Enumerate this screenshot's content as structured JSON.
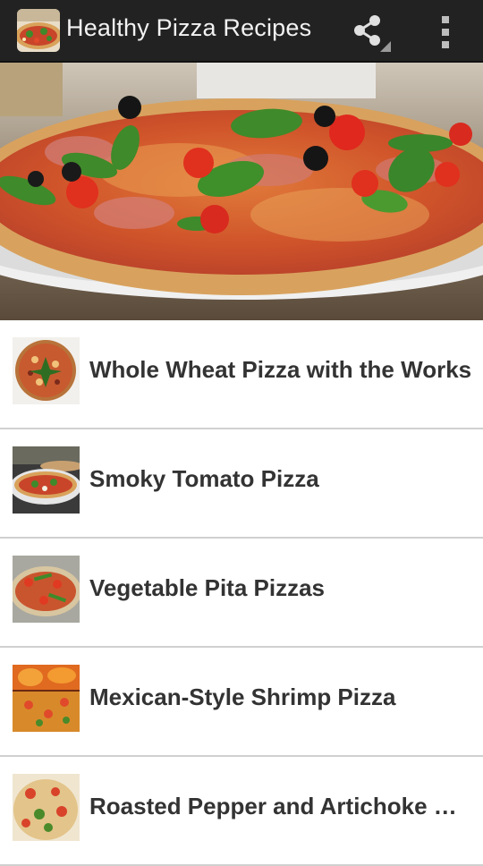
{
  "action_bar": {
    "title": "Healthy Pizza Recipes",
    "app_icon": "pizza-app-icon",
    "share_icon": "share-icon",
    "overflow_icon": "overflow-menu-icon"
  },
  "hero": {
    "image": "pizza-photo"
  },
  "recipes": [
    {
      "title": "Whole Wheat Pizza with the Works",
      "thumb": "whole-wheat-pizza-thumbnail"
    },
    {
      "title": "Smoky Tomato Pizza",
      "thumb": "smoky-tomato-pizza-thumbnail"
    },
    {
      "title": "Vegetable Pita Pizzas",
      "thumb": "vegetable-pita-pizzas-thumbnail"
    },
    {
      "title": "Mexican-Style Shrimp Pizza",
      "thumb": "mexican-shrimp-pizza-thumbnail"
    },
    {
      "title": "Roasted Pepper and Artichoke Pi…",
      "thumb": "roasted-pepper-pizza-thumbnail"
    }
  ],
  "colors": {
    "action_bar": "#222222",
    "divider": "#d0d0d0",
    "title_text": "#333333",
    "crust": "#d9a25a",
    "sauce": "#c8452a",
    "basil": "#3f8a2a",
    "olive": "#151515"
  }
}
